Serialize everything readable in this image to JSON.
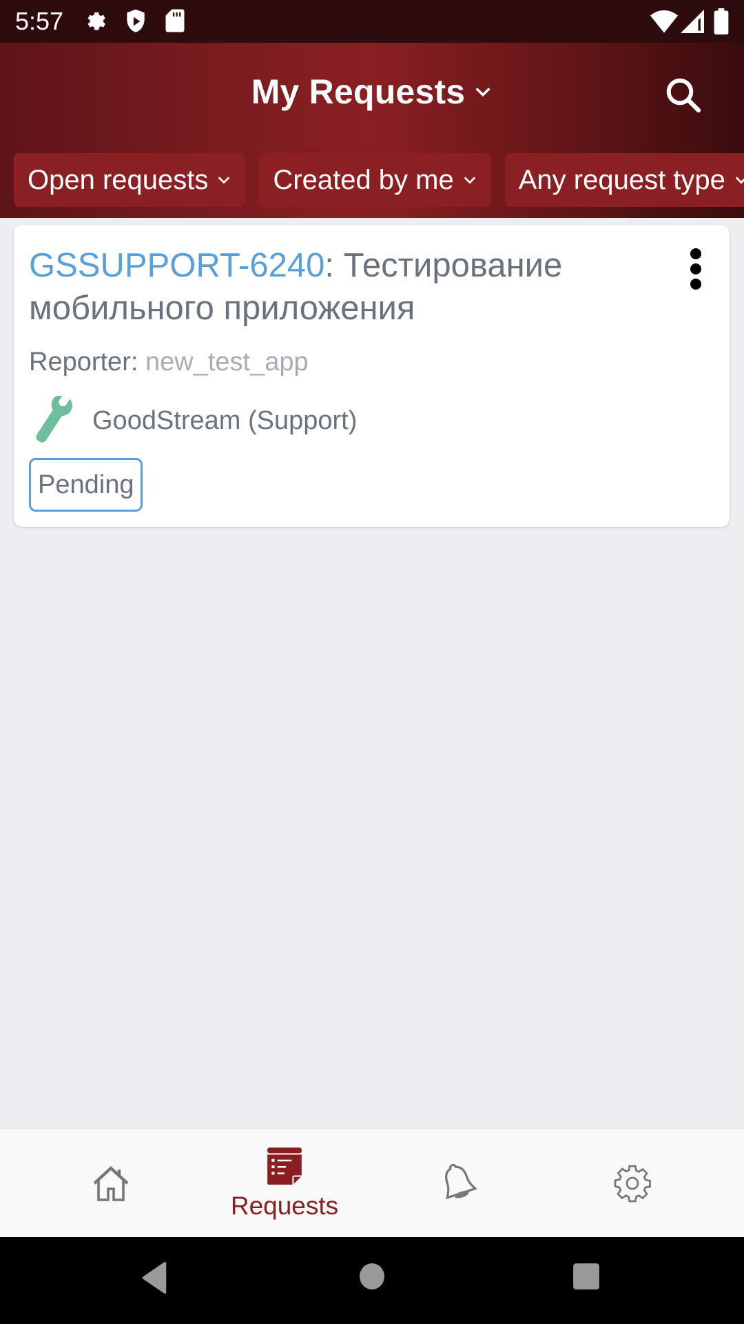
{
  "status_bar": {
    "time": "5:57",
    "left_icons": [
      "settings-icon",
      "shield-play-icon",
      "sd-card-icon"
    ],
    "right_icons": [
      "wifi-icon",
      "cell-signal-icon",
      "battery-icon"
    ]
  },
  "header": {
    "title": "My Requests",
    "title_icon": "chevron-down-icon",
    "search_icon": "search-icon"
  },
  "filters": [
    {
      "label": "Open requests",
      "icon": "chevron-down-icon"
    },
    {
      "label": "Created by me",
      "icon": "chevron-down-icon"
    },
    {
      "label": "Any request type",
      "icon": "chevron-down-icon"
    }
  ],
  "requests": [
    {
      "key": "GSSUPPORT-6240",
      "separator": ": ",
      "summary": "Тестирование мобильного приложения",
      "reporter_label": "Reporter",
      "reporter_separator": ": ",
      "reporter_value": "new_test_app",
      "project_icon": "wrench-icon",
      "project": "GoodStream (Support)",
      "status": "Pending",
      "menu_icon": "more-vertical-icon"
    }
  ],
  "bottom_nav": {
    "items": [
      {
        "name": "home",
        "icon": "home-icon",
        "label": "",
        "active": false
      },
      {
        "name": "requests",
        "icon": "requests-icon",
        "label": "Requests",
        "active": true
      },
      {
        "name": "notifications",
        "icon": "bell-icon",
        "label": "",
        "active": false
      },
      {
        "name": "settings",
        "icon": "gear-icon",
        "label": "",
        "active": false
      }
    ]
  },
  "system_nav": [
    "back-icon",
    "home-circle-icon",
    "recents-icon"
  ],
  "colors": {
    "brand": "#8a1f23",
    "link": "#58a0dc",
    "badge_border": "#5a9edb",
    "wrench": "#6cbf9a",
    "text_secondary": "#6a737d",
    "background": "#edeef2"
  }
}
